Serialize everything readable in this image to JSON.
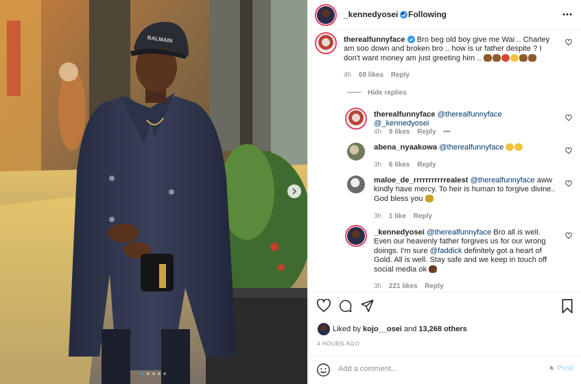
{
  "header": {
    "username": "_kennedyosei",
    "separator": "•",
    "follow_status": "Following"
  },
  "comments": [
    {
      "username": "therealfunnyface",
      "text": "Bro beg old boy give me Wai .. Charley am soo down and broken bro .. how is ur father despite ? I don't want money am just greeting him ..",
      "time": "4h",
      "likes": "68 likes",
      "reply": "Reply"
    }
  ],
  "hide_replies": "Hide replies",
  "replies": [
    {
      "username": "therealfunnyface",
      "mentions": [
        "@therealfunnyface",
        "@_kennedyosei"
      ],
      "text": "",
      "time": "4h",
      "likes": "9 likes",
      "reply": "Reply",
      "more": "•••"
    },
    {
      "username": "abena_nyaakowa",
      "mentions": [
        "@therealfunnyface"
      ],
      "text": "",
      "time": "3h",
      "likes": "6 likes",
      "reply": "Reply"
    },
    {
      "username": "maloe_de_rrrrrrrrrrrealest",
      "mentions": [
        "@therealfunnyface"
      ],
      "text": "aww kindly have mercy. To heir is human to forgive divine.. God bless you",
      "time": "3h",
      "likes": "1 like",
      "reply": "Reply"
    },
    {
      "username": "_kennedyosei",
      "mentions": [
        "@therealfunnyface",
        "@faddick"
      ],
      "text_a": "Bro all is well. Even our heavenly father forgives us for our wrong doings. I'm sure",
      "text_b": "definitely got a heart of Gold. All is well. Stay safe and we keep in touch off social media ok",
      "time": "3h",
      "likes": "221 likes",
      "reply": "Reply"
    }
  ],
  "likes": {
    "prefix": "Liked by",
    "user": "kojo__osei",
    "and": "and",
    "count": "13,268 others"
  },
  "time_ago": "4 HOURS AGO",
  "comment_box": {
    "placeholder": "Add a comment...",
    "post_label": "Post"
  },
  "photo": {
    "cap_text": "BALMAIN",
    "carousel_pages": 5,
    "carousel_active": 1
  },
  "colors": {
    "link": "#00376b",
    "muted": "#8e8e8e",
    "post_disabled": "#b2dffc",
    "verified": "#3897f0",
    "story_ring": "#e0405f"
  }
}
